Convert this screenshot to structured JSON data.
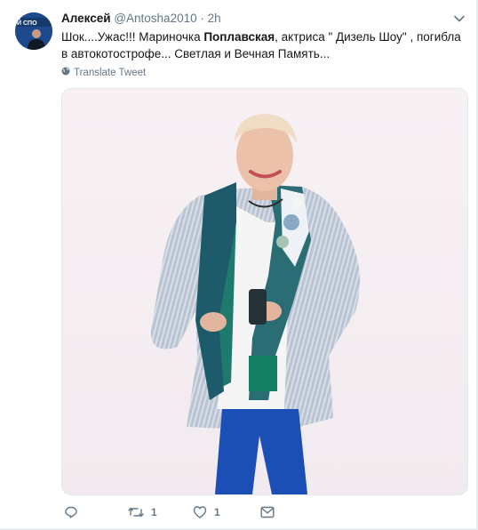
{
  "tweet": {
    "author_name": "Алексей",
    "author_handle": "@Antosha2010",
    "separator": "·",
    "time": "2h",
    "text_prefix": "Шок....Ужас!!! Мариночка ",
    "text_bold": "Поплавская",
    "text_suffix": ", актриса \" Дизель Шоу\" , погибла в автокотострофе...  Светлая и Вечная Память...",
    "translate_label": "Translate Tweet",
    "retweet_count": "1",
    "like_count": "1",
    "avatar_text": "Й СПО"
  },
  "icons": {
    "caret": "chevron-down-icon",
    "globe": "globe-icon",
    "reply": "reply-icon",
    "retweet": "retweet-icon",
    "like": "heart-icon",
    "dm": "envelope-icon"
  },
  "colors": {
    "name": "#14171a",
    "meta": "#657786",
    "background": "#e6ecf0"
  }
}
